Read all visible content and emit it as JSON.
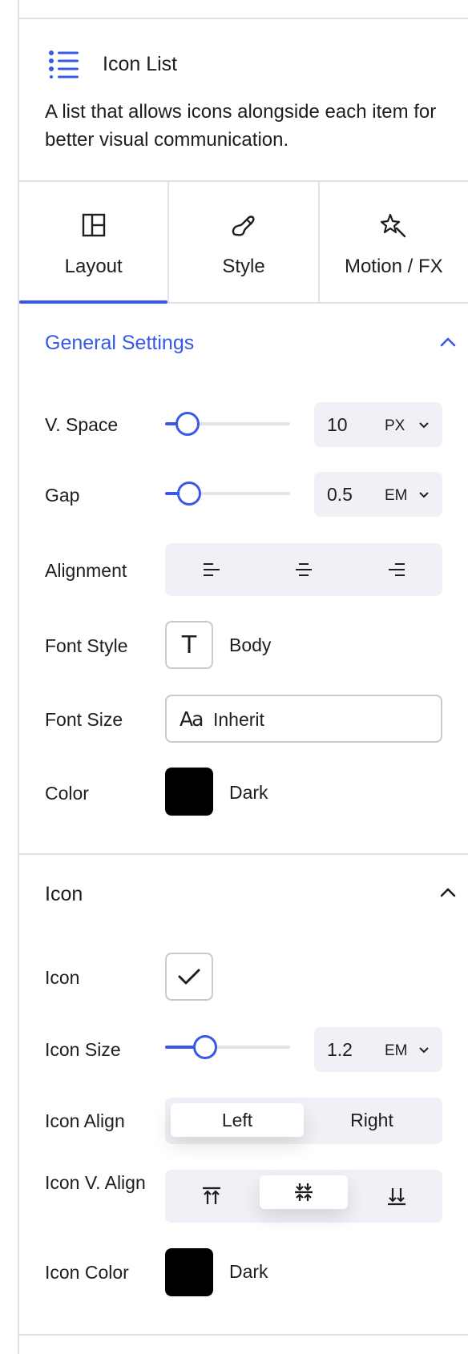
{
  "block": {
    "icon": "list-bullets-icon",
    "title": "Icon List",
    "description": "A list that allows icons alongside each item for better visual communication."
  },
  "tabs": [
    {
      "label": "Layout",
      "icon": "layout-grid-icon",
      "active": true
    },
    {
      "label": "Style",
      "icon": "brush-icon",
      "active": false
    },
    {
      "label": "Motion / FX",
      "icon": "sparkle-star-icon",
      "active": false
    }
  ],
  "general": {
    "title": "General Settings",
    "v_space": {
      "label": "V. Space",
      "value": "10",
      "unit": "PX",
      "level": 0.18
    },
    "gap": {
      "label": "Gap",
      "value": "0.5",
      "unit": "EM",
      "level": 0.19
    },
    "alignment": {
      "label": "Alignment",
      "options": [
        "align-left-icon",
        "align-center-icon",
        "align-right-icon"
      ]
    },
    "font_style": {
      "label": "Font Style",
      "glyph": "T",
      "value": "Body"
    },
    "font_size": {
      "label": "Font Size",
      "glyph": "Aa",
      "value": "Inherit"
    },
    "color": {
      "label": "Color",
      "swatch": "#000000",
      "value": "Dark"
    }
  },
  "icon_section": {
    "title": "Icon",
    "icon": {
      "label": "Icon",
      "glyph": "check-icon"
    },
    "icon_size": {
      "label": "Icon Size",
      "value": "1.2",
      "unit": "EM",
      "level": 0.32
    },
    "icon_align": {
      "label": "Icon Align",
      "options": [
        "Left",
        "Right"
      ],
      "selected": "Left"
    },
    "icon_v_align": {
      "label": "Icon V. Align",
      "options": [
        "align-top-icon",
        "align-middle-icon",
        "align-bottom-icon"
      ],
      "selected": "align-middle-icon"
    },
    "icon_color": {
      "label": "Icon Color",
      "swatch": "#000000",
      "value": "Dark"
    }
  },
  "accent": "#3858e9"
}
